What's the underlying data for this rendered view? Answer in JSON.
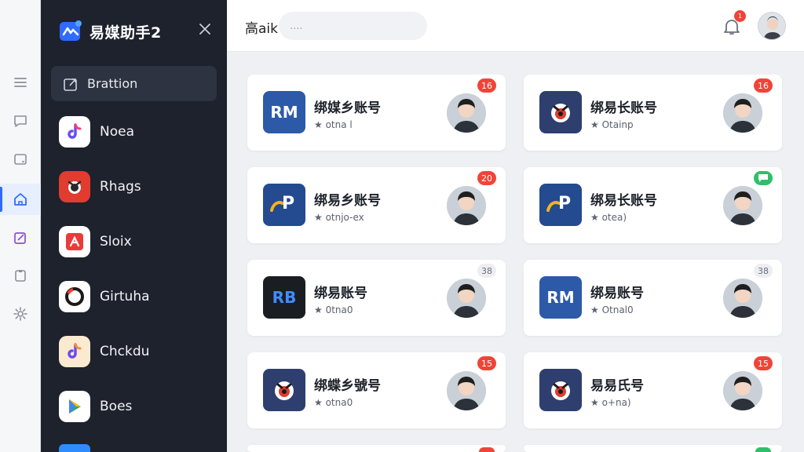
{
  "app": {
    "name": "易媒助手2",
    "colors": {
      "drawer_bg": "#1d222d",
      "accent": "#2f6bff",
      "badge_red": "#f04438",
      "badge_green": "#2fbf6a"
    }
  },
  "rail": {
    "items": [
      {
        "icon": "menu-icon"
      },
      {
        "icon": "chat-icon"
      },
      {
        "icon": "window-icon"
      },
      {
        "icon": "home-icon",
        "active": true
      },
      {
        "icon": "edit-icon"
      },
      {
        "icon": "clipboard-icon"
      },
      {
        "icon": "gear-icon"
      }
    ]
  },
  "drawer": {
    "active_label": "Brattion",
    "apps": [
      {
        "label": "Noea",
        "icon": "tiktok-icon"
      },
      {
        "label": "Rhags",
        "icon": "red-dog-icon"
      },
      {
        "label": "Sloix",
        "icon": "red-spark-icon"
      },
      {
        "label": "Girtuha",
        "icon": "circle-icon"
      },
      {
        "label": "Chckdu",
        "icon": "note-icon"
      },
      {
        "label": "Boes",
        "icon": "play-icon"
      }
    ]
  },
  "header": {
    "title": "高aik",
    "search_placeholder": "....",
    "notification_count": "1"
  },
  "cards": [
    {
      "title": "绑媒乡账号",
      "sub": "★ otna l",
      "logo_text": "RM",
      "logo_kind": "text-white-blue",
      "badge": "16",
      "badge_kind": "red"
    },
    {
      "title": "绑易长账号",
      "sub": "★ Otainp",
      "logo_text": "",
      "logo_kind": "dog",
      "badge": "16",
      "badge_kind": "red"
    },
    {
      "title": "绑易乡账号",
      "sub": "★ otnjo-ex",
      "logo_text": "P",
      "logo_kind": "p-logo",
      "badge": "20",
      "badge_kind": "red"
    },
    {
      "title": "绑易长账号",
      "sub": "★ otea)",
      "logo_text": "P",
      "logo_kind": "p-logo",
      "badge": "",
      "badge_kind": "green"
    },
    {
      "title": "绑易账号",
      "sub": "★ 0tna0",
      "logo_text": "RB",
      "logo_kind": "text-blue-black",
      "badge": "38",
      "badge_kind": "gray"
    },
    {
      "title": "绑易账号",
      "sub": "★ Otnal0",
      "logo_text": "RM",
      "logo_kind": "text-white-blue",
      "badge": "38",
      "badge_kind": "gray"
    },
    {
      "title": "绑蝶乡號号",
      "sub": "★ otna0",
      "logo_text": "",
      "logo_kind": "dog",
      "badge": "15",
      "badge_kind": "red"
    },
    {
      "title": "易易氏号",
      "sub": "★ o+na)",
      "logo_text": "",
      "logo_kind": "dog",
      "badge": "15",
      "badge_kind": "red"
    }
  ]
}
